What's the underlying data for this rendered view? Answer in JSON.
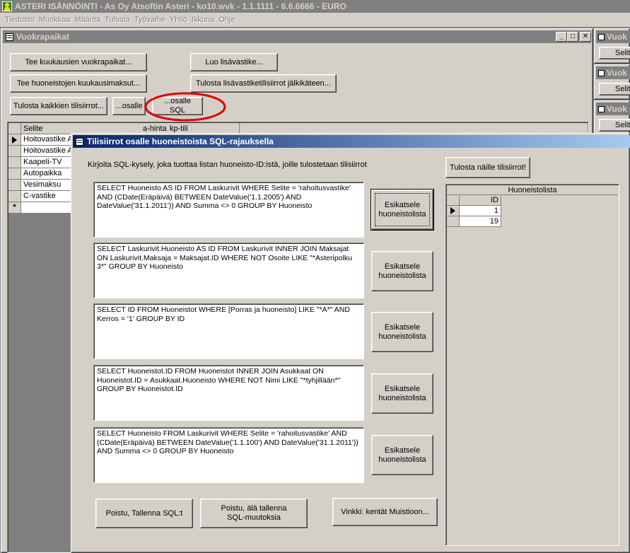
{
  "app": {
    "title": "ASTERI ISÄNNÖINTI - As Oy Atsoftin Asteri - ko10.wvk - 1.1.1111 - 6.6.6666 - EURO"
  },
  "menu": [
    "Tiedosto",
    "Muokkaa",
    "Määritä",
    "Tulosta",
    "Työvaihe",
    "Yhtiö",
    "Ikkuna",
    "Ohje"
  ],
  "vuokra_window": {
    "title": "Vuokrapaikat",
    "buttons": {
      "monthly_rents": "Tee kuukausien vuokrapaikat...",
      "apartment_fees": "Tee huoneistojen kuukausimaksut...",
      "print_all": "Tulosta kaikkien tilisiirrot...",
      "create_extra": "Luo lisävastike...",
      "print_extra": "Tulosta lisävastiketilisiirrot jälkikäteen...",
      "partial": "...osalle",
      "partial_sql": "...osalle SQL"
    },
    "grid": {
      "headers": [
        "Selite",
        "a-hinta",
        "kp-tili"
      ],
      "rows": [
        "Hoitovastike A",
        "Hoitovastike A",
        "Kaapeli-TV",
        "Autopaikka",
        "Vesimaksu",
        "C-vastike"
      ],
      "new_row_marker": "*"
    }
  },
  "side_windows": [
    {
      "title": "Vuok",
      "button": "Selit"
    },
    {
      "title": "Vuok",
      "button": "Selit"
    },
    {
      "title": "Vuok",
      "button": "Selit"
    }
  ],
  "dialog": {
    "title": "Tilisiirrot osalle huoneistoista SQL-rajauksella",
    "instruction": "Kirjoita SQL-kysely, joka tuottaa listan huoneisto-ID:istä, joille tulostetaan tilisiirrot",
    "print_button": "Tulosta näille tilisiirrot!",
    "preview_label": "Esikatsele\nhuoneistolista",
    "queries": [
      "SELECT Huoneisto AS ID FROM Laskurivit WHERE Selite = 'rahoitusvastike' AND (CDate(Eräpäivä) BETWEEN DateValue('1.1.2005') AND DateValue('31.1.2011')) AND Summa <> 0 GROUP BY Huoneisto",
      "SELECT Laskurivit.Huoneisto AS ID FROM Laskurivit INNER JOIN Maksajat ON Laskurivit.Maksaja = Maksajat.ID WHERE NOT Osoite LIKE \"*Asteripolku 3*\" GROUP BY Huoneisto",
      "SELECT ID FROM Huoneistot WHERE [Porras ja huoneisto] LIKE \"*A*\" AND Kerros = '1' GROUP BY ID",
      "SELECT Huoneistot.ID FROM Huoneistot INNER JOIN Asukkaat ON Huoneistot.ID = Asukkaat.Huoneisto WHERE NOT Nimi LIKE \"*tyhjillään*\" GROUP BY Huoneistot.ID",
      "SELECT Huoneisto FROM Laskurivit WHERE Selite = 'rahoitusvastike' AND (CDate(Eräpäivä) BETWEEN DateValue('1.1.100') AND DateValue('31.1.2011')) AND Summa <> 0 GROUP BY Huoneisto"
    ],
    "list": {
      "title": "Huoneistolista",
      "column": "ID",
      "values": [
        "1",
        "19"
      ]
    },
    "bottom_buttons": {
      "save_exit": "Poistu, Tallenna SQL:t",
      "exit_nosave": "Poistu, älä tallenna\nSQL-muutoksia",
      "tip": "Vinkki: kentät Muistioon..."
    }
  },
  "colors": {
    "face": "#d4d0c8",
    "active_title": "#0a246a",
    "inactive_title": "#808080",
    "highlight_circle": "#e00000"
  }
}
